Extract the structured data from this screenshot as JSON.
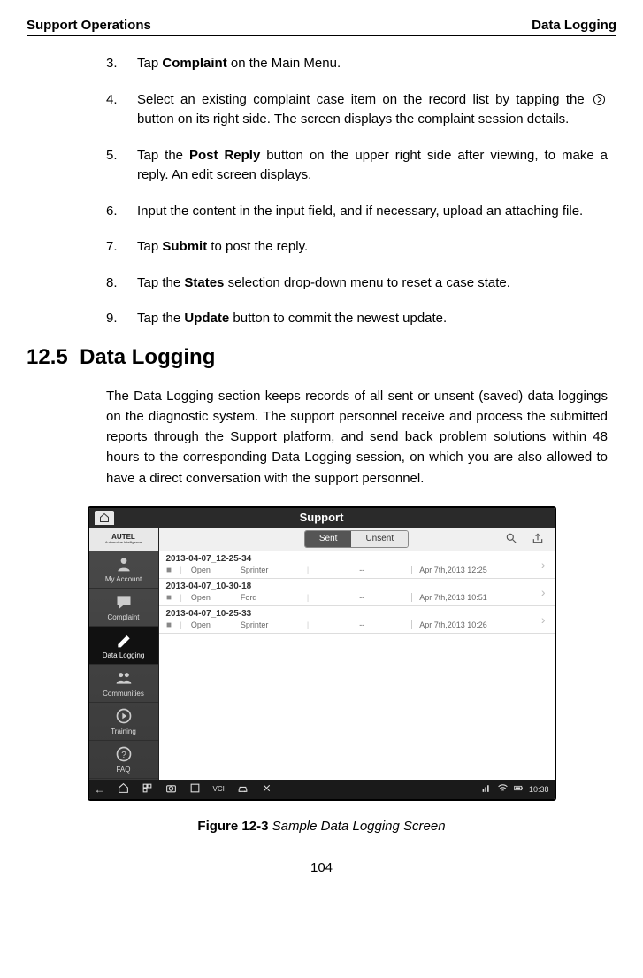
{
  "header": {
    "left": "Support Operations",
    "right": "Data Logging"
  },
  "steps": [
    {
      "num": "3.",
      "pre": "Tap ",
      "bold": "Complaint",
      "post": " on the Main Menu."
    },
    {
      "num": "4.",
      "full": "Select an existing complaint case item on the record list by tapping the ",
      "post2": " button on its right side. The screen displays the complaint session details.",
      "icon": true
    },
    {
      "num": "5.",
      "pre": "Tap the ",
      "bold": "Post Reply",
      "post": " button on the upper right side after viewing, to make a reply. An edit screen displays."
    },
    {
      "num": "6.",
      "plain": "Input the content in the input field, and if necessary, upload an attaching file."
    },
    {
      "num": "7.",
      "pre": "Tap ",
      "bold": "Submit",
      "post": " to post the reply."
    },
    {
      "num": "8.",
      "pre": "Tap the ",
      "bold": "States",
      "post": " selection drop-down menu to reset a case state."
    },
    {
      "num": "9.",
      "pre": "Tap the ",
      "bold": "Update",
      "post": " button to commit the newest update."
    }
  ],
  "section": {
    "num": "12.5",
    "title": "Data Logging"
  },
  "paragraph": "The Data Logging section keeps records of all sent or unsent (saved) data loggings on the diagnostic system. The support personnel receive and process the submitted reports through the Support platform, and send back problem solutions within 48 hours to the corresponding Data Logging session, on which you are also allowed to have a direct conversation with the support personnel.",
  "screenshot": {
    "title": "Support",
    "logo": "AUTEL",
    "logoSub": "Automotive Intelligence",
    "sidebar": [
      "My Account",
      "Complaint",
      "Data Logging",
      "Communities",
      "Training",
      "FAQ"
    ],
    "tabs": {
      "sent": "Sent",
      "unsent": "Unsent"
    },
    "rows": [
      {
        "title": "2013-04-07_12-25-34",
        "status": "Open",
        "vehicle": "Sprinter",
        "mid": "--",
        "date": "Apr 7th,2013 12:25"
      },
      {
        "title": "2013-04-07_10-30-18",
        "status": "Open",
        "vehicle": "Ford",
        "mid": "--",
        "date": "Apr 7th,2013 10:51"
      },
      {
        "title": "2013-04-07_10-25-33",
        "status": "Open",
        "vehicle": "Sprinter",
        "mid": "--",
        "date": "Apr 7th,2013 10:26"
      }
    ],
    "dock": {
      "vci": "VCI",
      "time": "10:38"
    }
  },
  "caption": {
    "bold": "Figure 12-3",
    "italic": " Sample Data Logging Screen"
  },
  "pageNum": "104"
}
